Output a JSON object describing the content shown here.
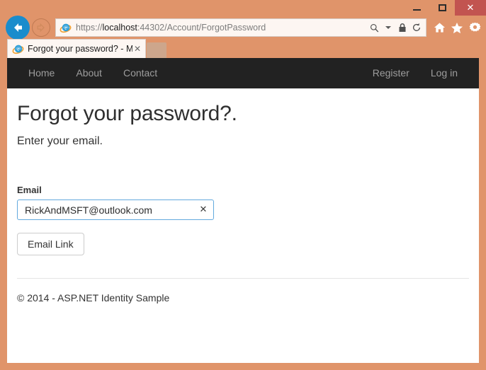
{
  "browser": {
    "window_controls": {
      "minimize_label": "—",
      "maximize_label": "□",
      "close_label": "✕"
    },
    "back_icon": "back-arrow-icon",
    "forward_icon": "forward-arrow-icon",
    "address": {
      "scheme": "https://",
      "host": "localhost",
      "path": ":44302/Account/ForgotPassword",
      "full_url": "https://localhost:44302/Account/ForgotPassword"
    },
    "address_icons": [
      "search-icon",
      "chevron-down-icon",
      "lock-icon",
      "refresh-icon"
    ],
    "toolbar_icons": [
      "home-icon",
      "favorites-star-icon",
      "settings-gear-icon"
    ],
    "tab": {
      "title": "Forgot your password? - M...",
      "close_label": "✕",
      "favicon": "internet-explorer-icon"
    },
    "new_tab_label": ""
  },
  "site": {
    "nav_left": [
      {
        "label": "Home"
      },
      {
        "label": "About"
      },
      {
        "label": "Contact"
      }
    ],
    "nav_right": [
      {
        "label": "Register"
      },
      {
        "label": "Log in"
      }
    ]
  },
  "main": {
    "title": "Forgot your password?.",
    "subtitle": "Enter your email.",
    "form": {
      "email_label": "Email",
      "email_value": "RickAndMSFT@outlook.com",
      "email_placeholder": "",
      "clear_label": "✕",
      "submit_label": "Email Link"
    },
    "footer": "© 2014 - ASP.NET Identity Sample"
  },
  "colors": {
    "window_frame": "#e0946a",
    "close_button": "#c25450",
    "navbar": "#222222",
    "nav_link": "#9d9d9d",
    "input_focus_border": "#62a9de",
    "back_button": "#1a8ccc"
  }
}
